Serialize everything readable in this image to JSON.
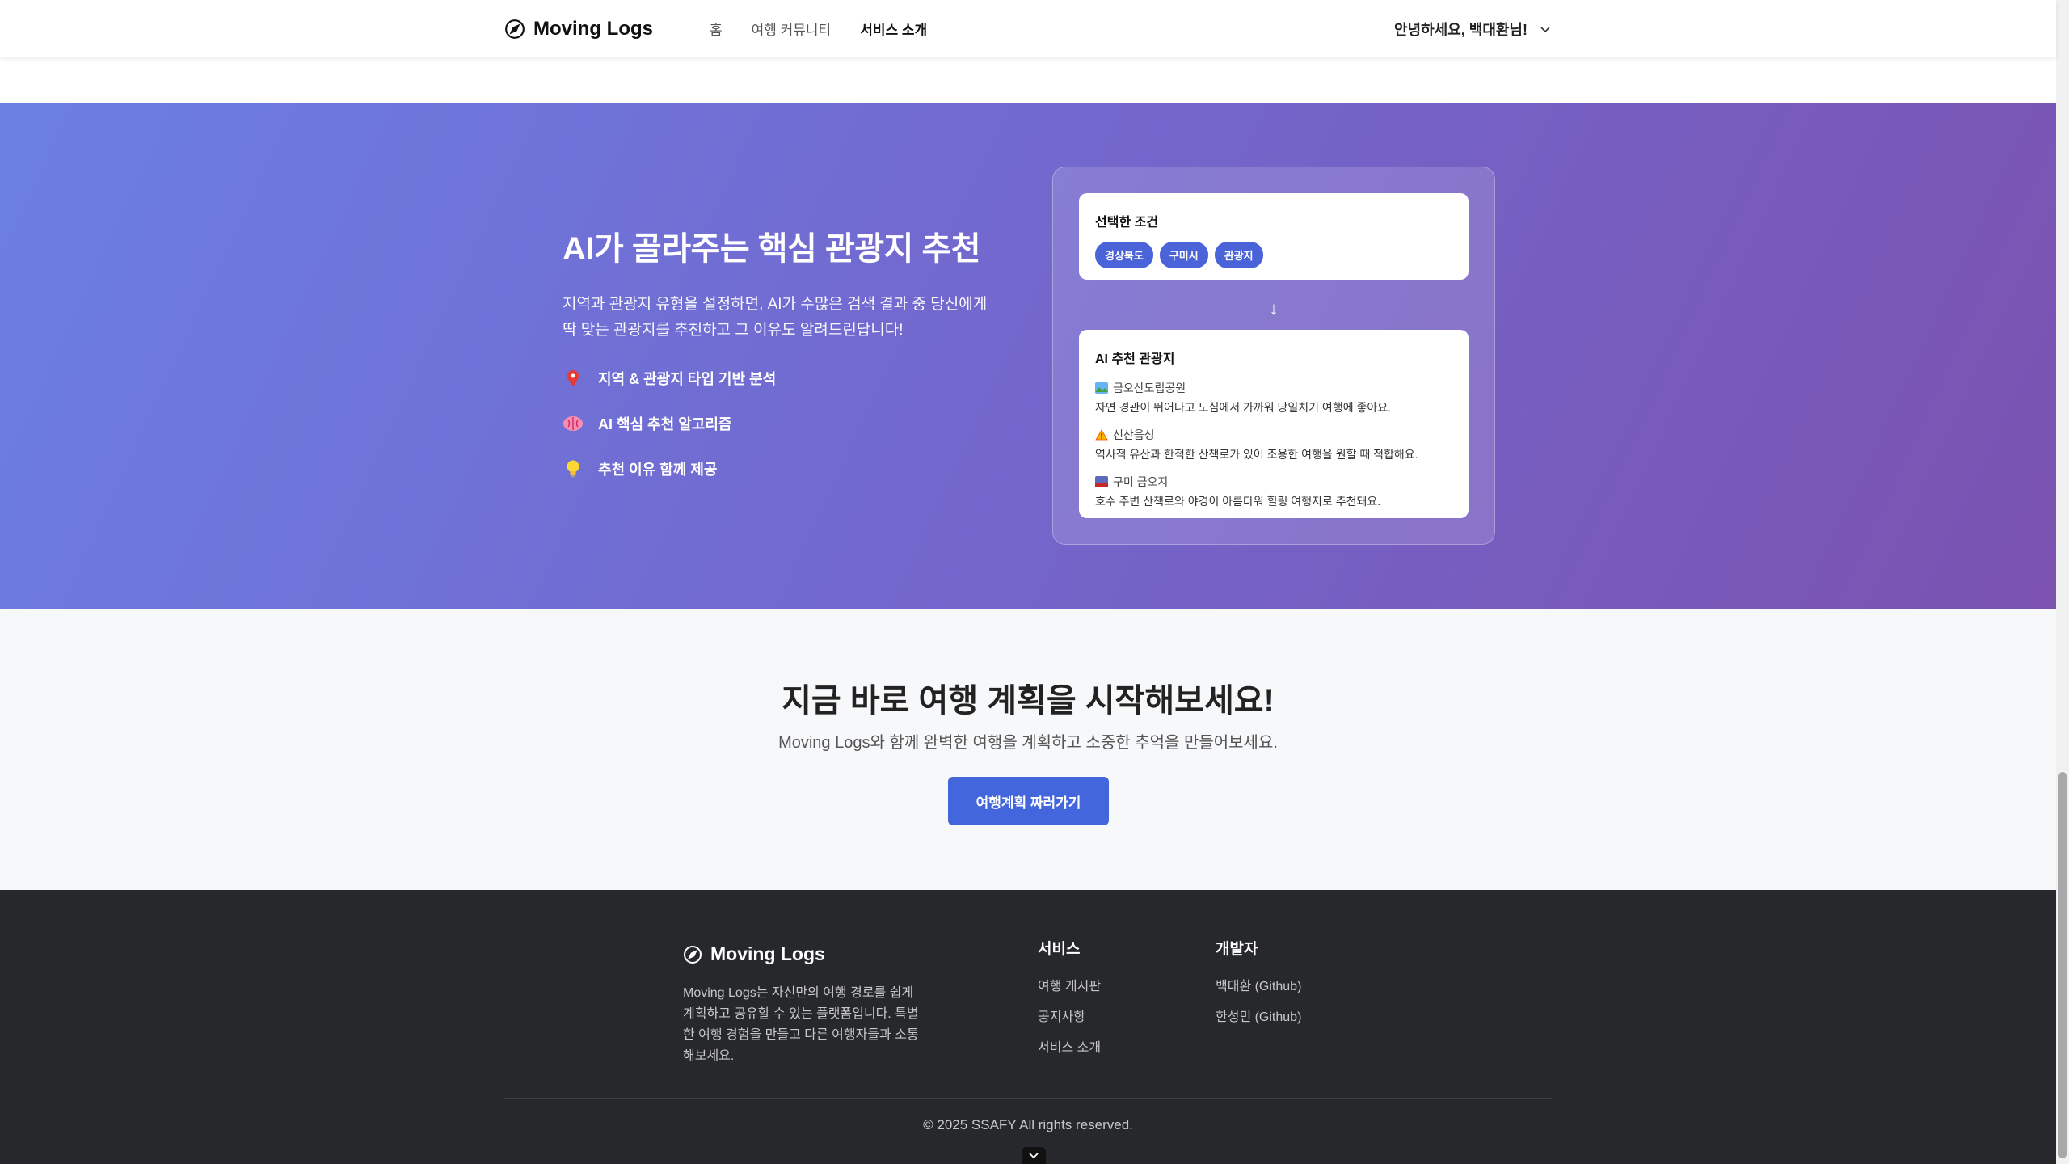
{
  "header": {
    "logo_text": "Moving Logs",
    "nav": [
      "홈",
      "여행 커뮤니티",
      "서비스 소개"
    ],
    "active_nav_index": 2,
    "user_greeting": "안녕하세요, 백대환님!"
  },
  "hero": {
    "title": "AI가 골라주는 핵심 관광지 추천",
    "desc_line1": "지역과 관광지 유형을 설정하면, AI가 수많은 검색 결과 중 당신에게",
    "desc_line2": "딱 맞는 관광지를 추천하고 그 이유도 알려드린답니다!",
    "features": [
      {
        "icon": "pin-icon",
        "label": "지역 & 관광지 타입 기반 분석"
      },
      {
        "icon": "brain-icon",
        "label": "AI 핵심 추천 알고리즘"
      },
      {
        "icon": "lightbulb-icon",
        "label": "추천 이유 함께 제공"
      }
    ],
    "conditions_title": "선택한 조건",
    "conditions": [
      "경상북도",
      "구미시",
      "관광지"
    ],
    "arrow": "↓",
    "rec_title": "AI 추천 관광지",
    "recommendations": [
      {
        "icon": "landscape-icon",
        "name": "금오산도립공원",
        "desc": "자연 경관이 뛰어나고 도심에서 가까워 당일치기 여행에 좋아요."
      },
      {
        "icon": "warning-icon",
        "name": "선산읍성",
        "desc": "역사적 유산과 한적한 산책로가 있어 조용한 여행을 원할 때 적합해요."
      },
      {
        "icon": "lake-icon",
        "name": "구미 금오지",
        "desc": "호수 주변 산책로와 야경이 아름다워 힐링 여행지로 추천돼요."
      }
    ]
  },
  "cta": {
    "title": "지금 바로 여행 계획을 시작해보세요!",
    "subtitle": "Moving Logs와 함께 완벽한 여행을 계획하고 소중한 추억을 만들어보세요.",
    "button": "여행계획 짜러가기"
  },
  "footer": {
    "logo_text": "Moving Logs",
    "description": "Moving Logs는 자신만의 여행 경로를 쉽게 계획하고 공유할 수 있는 플랫폼입니다. 특별한 여행 경험을 만들고 다른 여행자들과 소통해보세요.",
    "services_title": "서비스",
    "services": [
      "여행 게시판",
      "공지사항",
      "서비스 소개"
    ],
    "dev_title": "개발자",
    "developers": [
      "백대환 (Github)",
      "한성민 (Github)"
    ],
    "copyright": "© 2025 SSAFY All rights reserved."
  }
}
